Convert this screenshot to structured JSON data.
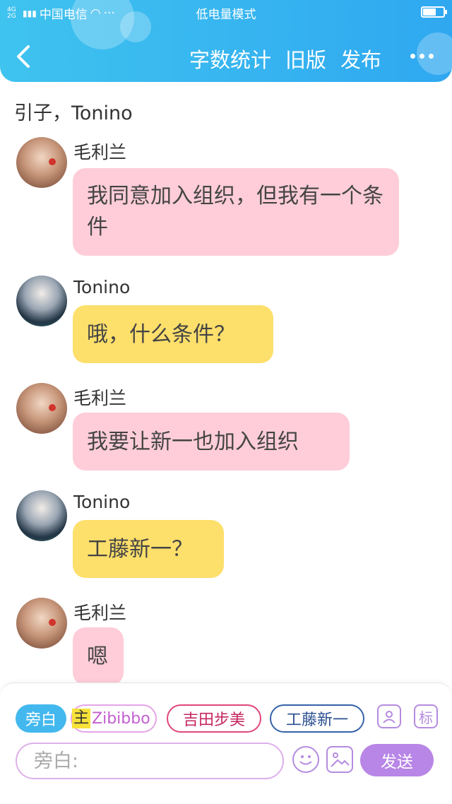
{
  "status_bar": {
    "network": "4G 2G",
    "carrier": "中国电信",
    "extra": "···",
    "mode": "低电量模式"
  },
  "nav": {
    "word_count": "字数统计",
    "old_version": "旧版",
    "publish": "发布"
  },
  "intro_text": "引子，Tonino",
  "messages": [
    {
      "sender": "毛利兰",
      "text": "我同意加入组织，但我有一个条件",
      "color": "#fecdd9"
    },
    {
      "sender": "Tonino",
      "text": "哦，什么条件？",
      "color": "#fddf6b"
    },
    {
      "sender": "毛利兰",
      "text": "我要让新一也加入组织",
      "color": "#fecdd9"
    },
    {
      "sender": "Tonino",
      "text": "工藤新一？",
      "color": "#fddf6b"
    },
    {
      "sender": "毛利兰",
      "text": "嗯",
      "color": "#fecdd9"
    }
  ],
  "roles": {
    "narration": "旁白",
    "main_tag": "主",
    "main": "Zibibbo",
    "ayumi": "吉田步美",
    "shinichi": "工藤新一",
    "tag_icon_label": "标"
  },
  "composer": {
    "placeholder": "旁白:",
    "send": "发送"
  }
}
